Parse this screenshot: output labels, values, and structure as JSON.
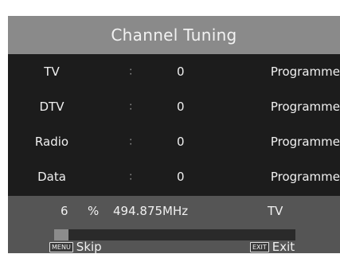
{
  "header": {
    "title": "Channel Tuning"
  },
  "rows": [
    {
      "label": "TV",
      "colon": ":",
      "count": "0",
      "unit": "Programme"
    },
    {
      "label": "DTV",
      "colon": ":",
      "count": "0",
      "unit": "Programme"
    },
    {
      "label": "Radio",
      "colon": ":",
      "count": "0",
      "unit": "Programme"
    },
    {
      "label": "Data",
      "colon": ":",
      "count": "0",
      "unit": "Programme"
    }
  ],
  "status": {
    "percent": "6",
    "percent_sign": "%",
    "frequency": "494.875MHz",
    "band": "TV",
    "progress_fraction": 0.06
  },
  "help": {
    "menu_key": "MENU",
    "menu_label": "Skip",
    "exit_key": "EXIT",
    "exit_label": "Exit"
  },
  "colors": {
    "title_bar": "#8a8a8a",
    "panel": "#1c1c1c",
    "footer": "#555555",
    "progress_fill": "#8c8c8c"
  }
}
